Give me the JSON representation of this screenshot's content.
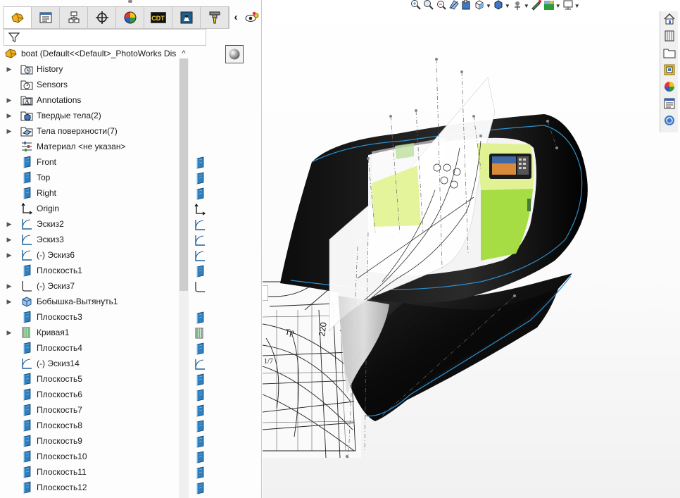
{
  "window": {
    "tabs": [
      {
        "name": "feature-manager"
      },
      {
        "name": "property-manager"
      },
      {
        "name": "configuration-manager"
      },
      {
        "name": "dimxpert-manager"
      },
      {
        "name": "display-manager"
      },
      {
        "name": "cam-feature-manager"
      },
      {
        "name": "cam-operation-manager"
      },
      {
        "name": "cam-tool-manager"
      }
    ],
    "cam_tab_label": "CDT",
    "collapse_glyph": "‹",
    "tree_up_glyph": "^"
  },
  "tree": {
    "root_label": "boat  (Default<<Default>_PhotoWorks Dis",
    "items": [
      {
        "label": "History",
        "icon": "history-folder-icon",
        "expandable": true
      },
      {
        "label": "Sensors",
        "icon": "sensors-folder-icon",
        "expandable": false
      },
      {
        "label": "Annotations",
        "icon": "annotations-folder-icon",
        "expandable": true
      },
      {
        "label": "Твердые тела(2)",
        "icon": "solid-bodies-folder-icon",
        "expandable": true
      },
      {
        "label": "Тела поверхности(7)",
        "icon": "surface-bodies-folder-icon",
        "expandable": true
      },
      {
        "label": "Материал <не указан>",
        "icon": "material-icon",
        "expandable": false
      },
      {
        "label": "Front",
        "icon": "plane-icon",
        "expandable": false
      },
      {
        "label": "Top",
        "icon": "plane-icon",
        "expandable": false
      },
      {
        "label": "Right",
        "icon": "plane-icon",
        "expandable": false
      },
      {
        "label": "Origin",
        "icon": "origin-icon",
        "expandable": false
      },
      {
        "label": "Эскиз2",
        "icon": "sketch-icon",
        "expandable": true
      },
      {
        "label": "Эскиз3",
        "icon": "sketch-icon",
        "expandable": true
      },
      {
        "label": "(-) Эскиз6",
        "icon": "sketch-icon",
        "expandable": true
      },
      {
        "label": "Плоскость1",
        "icon": "plane-icon",
        "expandable": false
      },
      {
        "label": "(-) Эскиз7",
        "icon": "sketch-3d-icon",
        "expandable": true
      },
      {
        "label": "Бобышка-Вытянуть1",
        "icon": "extrude-boss-icon",
        "expandable": true
      },
      {
        "label": "Плоскость3",
        "icon": "plane-icon",
        "expandable": false
      },
      {
        "label": "Кривая1",
        "icon": "curve-icon",
        "expandable": true
      },
      {
        "label": "Плоскость4",
        "icon": "plane-icon",
        "expandable": false
      },
      {
        "label": "(-) Эскиз14",
        "icon": "sketch-icon",
        "expandable": false
      },
      {
        "label": "Плоскость5",
        "icon": "plane-icon",
        "expandable": false
      },
      {
        "label": "Плоскость6",
        "icon": "plane-icon",
        "expandable": false
      },
      {
        "label": "Плоскость7",
        "icon": "plane-icon",
        "expandable": false
      },
      {
        "label": "Плоскость8",
        "icon": "plane-icon",
        "expandable": false
      },
      {
        "label": "Плоскость9",
        "icon": "plane-icon",
        "expandable": false
      },
      {
        "label": "Плоскость10",
        "icon": "plane-icon",
        "expandable": false
      },
      {
        "label": "Плоскость11",
        "icon": "plane-icon",
        "expandable": false
      },
      {
        "label": "Плоскость12",
        "icon": "plane-icon",
        "expandable": false
      }
    ]
  },
  "mini_column": {
    "rows": [
      {
        "index": 6,
        "icon": "plane-icon"
      },
      {
        "index": 7,
        "icon": "plane-icon"
      },
      {
        "index": 8,
        "icon": "plane-icon"
      },
      {
        "index": 9,
        "icon": "origin-icon"
      },
      {
        "index": 10,
        "icon": "sketch-icon"
      },
      {
        "index": 11,
        "icon": "sketch-icon"
      },
      {
        "index": 12,
        "icon": "sketch-icon"
      },
      {
        "index": 13,
        "icon": "plane-icon"
      },
      {
        "index": 14,
        "icon": "sketch-3d-icon"
      },
      {
        "index": 16,
        "icon": "plane-icon"
      },
      {
        "index": 17,
        "icon": "curve-icon"
      },
      {
        "index": 18,
        "icon": "plane-icon"
      },
      {
        "index": 19,
        "icon": "sketch-icon"
      },
      {
        "index": 20,
        "icon": "plane-icon"
      },
      {
        "index": 21,
        "icon": "plane-icon"
      },
      {
        "index": 22,
        "icon": "plane-icon"
      },
      {
        "index": 23,
        "icon": "plane-icon"
      },
      {
        "index": 24,
        "icon": "plane-icon"
      },
      {
        "index": 25,
        "icon": "plane-icon"
      },
      {
        "index": 26,
        "icon": "plane-icon"
      },
      {
        "index": 27,
        "icon": "plane-icon"
      }
    ]
  },
  "heads_up_toolbar": [
    {
      "name": "zoom-to-fit-icon",
      "dropdown": false
    },
    {
      "name": "zoom-to-area-icon",
      "dropdown": false
    },
    {
      "name": "previous-view-icon",
      "dropdown": false
    },
    {
      "name": "section-view-icon",
      "dropdown": false
    },
    {
      "name": "dynamic-annotation-icon",
      "dropdown": false
    },
    {
      "name": "view-orientation-icon",
      "dropdown": true
    },
    {
      "name": "display-style-icon",
      "dropdown": true
    },
    {
      "name": "hide-show-items-icon",
      "dropdown": true
    },
    {
      "name": "edit-appearance-icon",
      "dropdown": false
    },
    {
      "name": "apply-scene-icon",
      "dropdown": true
    },
    {
      "name": "view-settings-icon",
      "dropdown": true
    }
  ],
  "task_pane": [
    {
      "name": "solidworks-resources-icon"
    },
    {
      "name": "design-library-icon"
    },
    {
      "name": "file-explorer-icon"
    },
    {
      "name": "view-palette-icon"
    },
    {
      "name": "appearances-scenes-icon"
    },
    {
      "name": "custom-properties-icon"
    },
    {
      "name": "solidworks-forum-icon"
    }
  ],
  "drawing": {
    "dim_label": "220",
    "tp_label": "Tp",
    "fraction_label": "1/7"
  },
  "colors": {
    "hull_dark": "#141414",
    "hull_edge": "#2e8fd0",
    "highlight_yellow": "#dff28a",
    "highlight_green": "#a6dc44",
    "plane_blue": "#2f7fbf"
  }
}
